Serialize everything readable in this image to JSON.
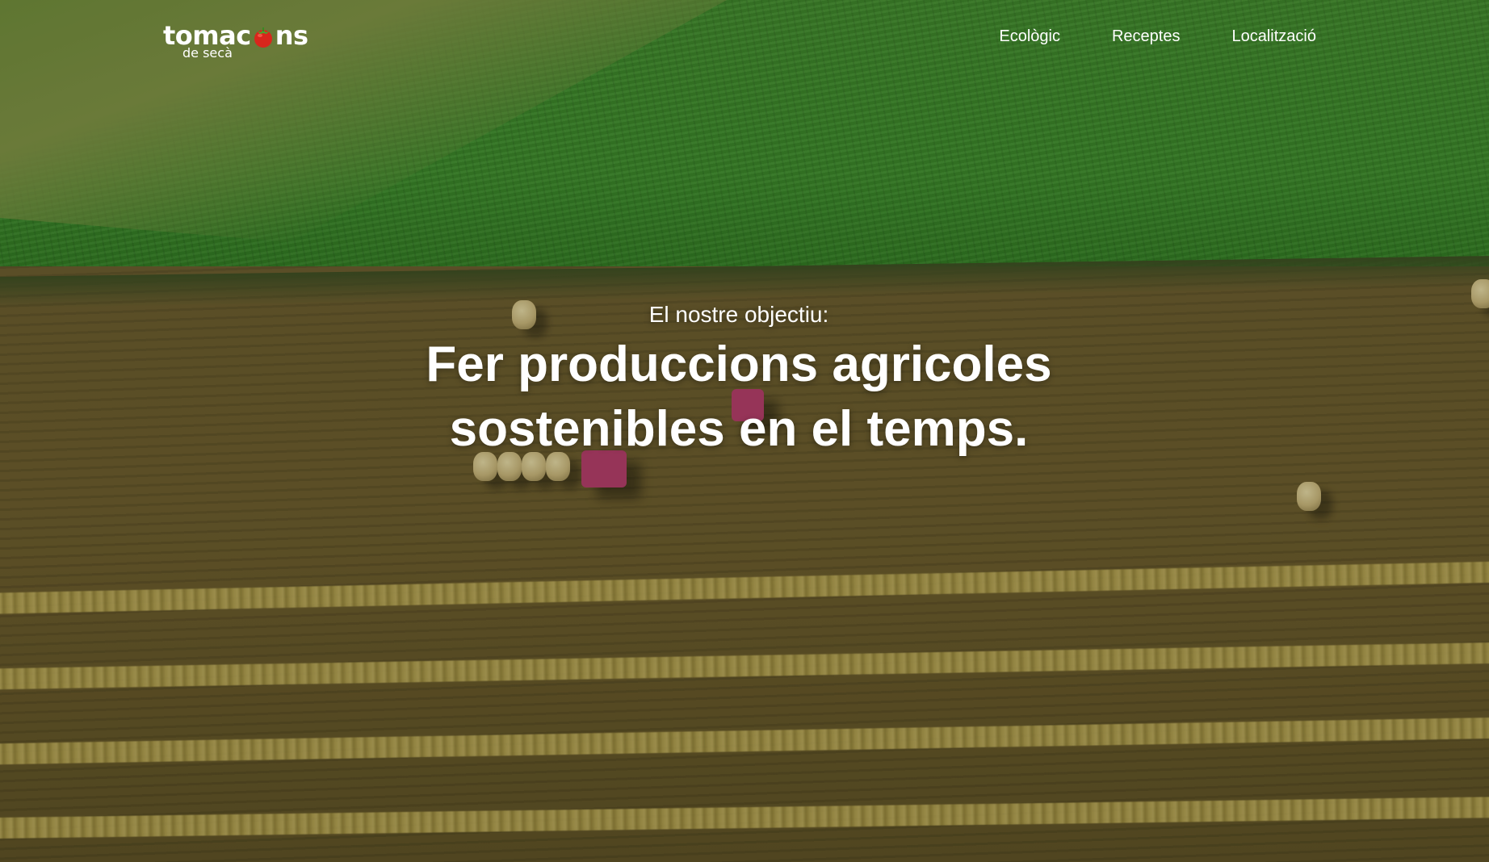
{
  "logo": {
    "word_start": "tomac",
    "word_end": "ns",
    "subtitle": "de secà",
    "icon": "tomato-icon"
  },
  "nav": {
    "items": [
      {
        "label": "Ecològic"
      },
      {
        "label": "Receptes"
      },
      {
        "label": "Localització"
      }
    ]
  },
  "hero": {
    "eyebrow": "El nostre objectiu:",
    "headline_line1": "Fer produccions agricoles",
    "headline_line2": "sostenibles en el temps."
  },
  "colors": {
    "text": "#ffffff",
    "tomato": "#d9261c",
    "crop_green": "#3a8a2a",
    "soil_brown": "#6b5a2c"
  }
}
